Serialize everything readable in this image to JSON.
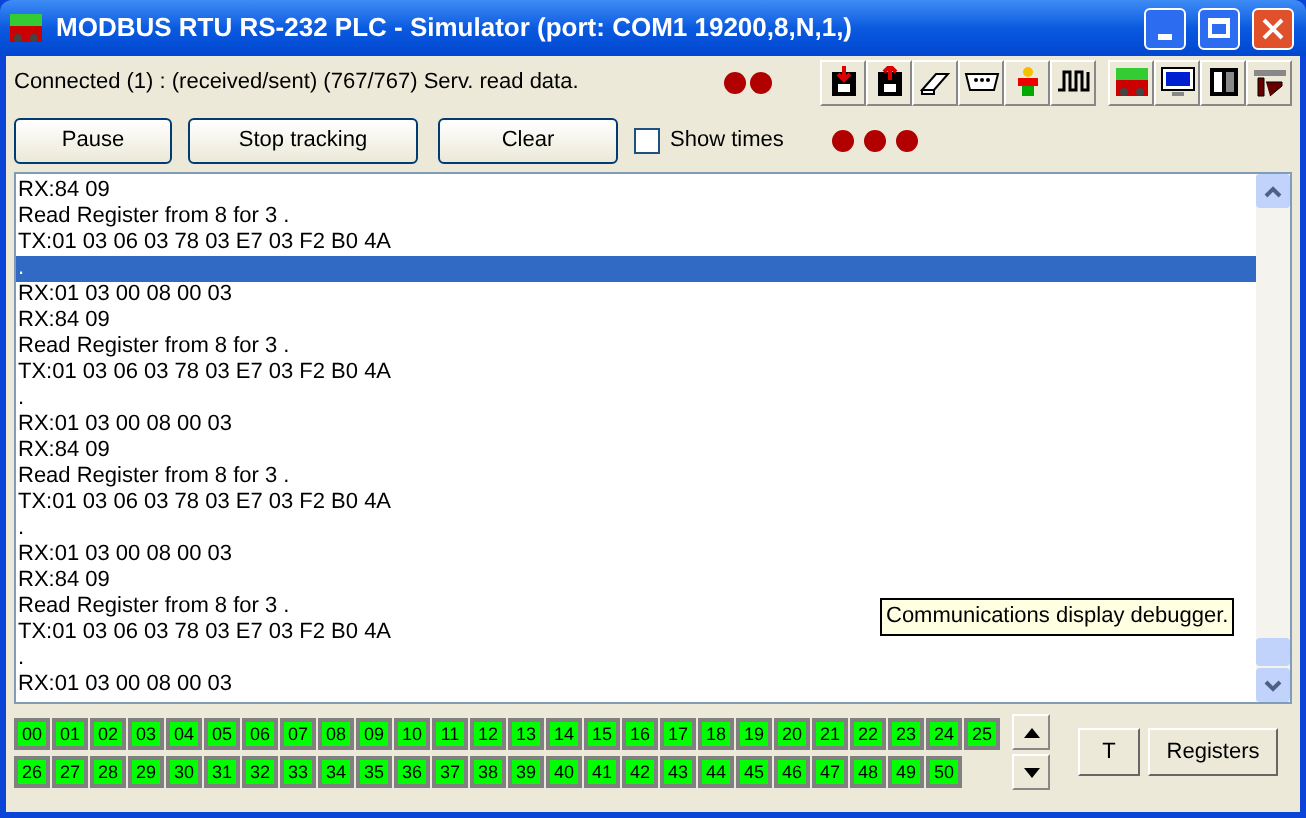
{
  "window": {
    "title": "MODBUS RTU RS-232 PLC - Simulator (port: COM1 19200,8,N,1,)"
  },
  "status": "Connected (1) : (received/sent) (767/767) Serv. read data.",
  "buttons": [
    "Pause",
    "Stop tracking",
    "Clear"
  ],
  "show_times": {
    "label": "Show times",
    "checked": false
  },
  "log": [
    {
      "text": "RX:84 09",
      "selected": false
    },
    {
      "text": "Read Register from 8 for 3 .",
      "selected": false
    },
    {
      "text": "TX:01 03 06 03 78 03 E7 03 F2 B0 4A",
      "selected": false
    },
    {
      "text": ".",
      "selected": true
    },
    {
      "text": "RX:01 03 00 08 00 03",
      "selected": false
    },
    {
      "text": "RX:84 09",
      "selected": false
    },
    {
      "text": "Read Register from 8 for 3 .",
      "selected": false
    },
    {
      "text": "TX:01 03 06 03 78 03 E7 03 F2 B0 4A",
      "selected": false
    },
    {
      "text": ".",
      "selected": false
    },
    {
      "text": "RX:01 03 00 08 00 03",
      "selected": false
    },
    {
      "text": "RX:84 09",
      "selected": false
    },
    {
      "text": "Read Register from 8 for 3 .",
      "selected": false
    },
    {
      "text": "TX:01 03 06 03 78 03 E7 03 F2 B0 4A",
      "selected": false
    },
    {
      "text": ".",
      "selected": false
    },
    {
      "text": "RX:01 03 00 08 00 03",
      "selected": false
    },
    {
      "text": "RX:84 09",
      "selected": false
    },
    {
      "text": "Read Register from 8 for 3 .",
      "selected": false
    },
    {
      "text": "TX:01 03 06 03 78 03 E7 03 F2 B0 4A",
      "selected": false
    },
    {
      "text": ".",
      "selected": false
    },
    {
      "text": "RX:01 03 00 08 00 03",
      "selected": false
    }
  ],
  "tooltip": "Communications display debugger.",
  "stations": [
    [
      "00",
      "01",
      "02",
      "03",
      "04",
      "05",
      "06",
      "07",
      "08",
      "09",
      "10",
      "11",
      "12",
      "13",
      "14",
      "15",
      "16",
      "17",
      "18",
      "19",
      "20",
      "21",
      "22",
      "23",
      "24",
      "25"
    ],
    [
      "26",
      "27",
      "28",
      "29",
      "30",
      "31",
      "32",
      "33",
      "34",
      "35",
      "36",
      "37",
      "38",
      "39",
      "40",
      "41",
      "42",
      "43",
      "44",
      "45",
      "46",
      "47",
      "48",
      "49",
      "50"
    ]
  ],
  "side_buttons": [
    "T",
    "Registers"
  ]
}
